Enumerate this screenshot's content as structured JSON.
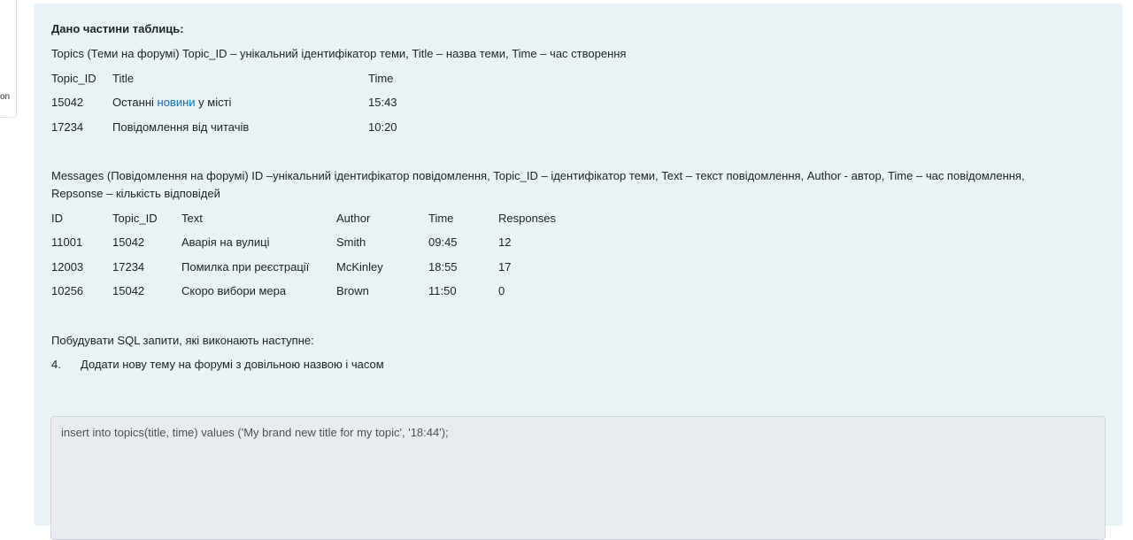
{
  "sidebar_fragment": "on",
  "question": {
    "heading": "Дано частини таблиць:",
    "topics_desc": "Topics (Теми на форумі) Topic_ID – унікальний ідентифікатор теми, Title – назва теми, Time – час створення",
    "topics_table": {
      "headers": [
        "Topic_ID",
        "Title",
        "Time"
      ],
      "rows": [
        {
          "id": "15042",
          "title_pre": "Останні ",
          "title_link": "новини",
          "title_post": " у місті",
          "time": "15:43"
        },
        {
          "id": "17234",
          "title": "Повідомлення від читачів",
          "time": "10:20"
        }
      ]
    },
    "messages_desc_line1": "Messages (Повідомлення на форумі) ID –унікальний ідентифікатор повідомлення, Topic_ID – ідентифікатор теми, Text – текст повідомлення, Author - автор, Time – час повідомлення,",
    "messages_desc_line2": "Repsonse – кількість відповідей",
    "messages_table": {
      "headers": [
        "ID",
        "Topic_ID",
        "Text",
        "Author",
        "Time",
        "Responses"
      ],
      "rows": [
        [
          "11001",
          "15042",
          "Аварія на вулиці",
          "Smith",
          "09:45",
          "12"
        ],
        [
          "12003",
          "17234",
          "Помилка при реєстрації",
          "McKinley",
          "18:55",
          "17"
        ],
        [
          "10256",
          "15042",
          "Скоро вибори мера",
          "Brown",
          "11:50",
          "0"
        ]
      ]
    },
    "task_intro": "Побудувати SQL запити, які виконають наступне:",
    "task_number": "4.",
    "task_text": "Додати нову тему на форумі з довільною назвою і часом"
  },
  "answer": {
    "value": "insert into topics(title, time) values ('My brand new title for my topic', '18:44');"
  }
}
